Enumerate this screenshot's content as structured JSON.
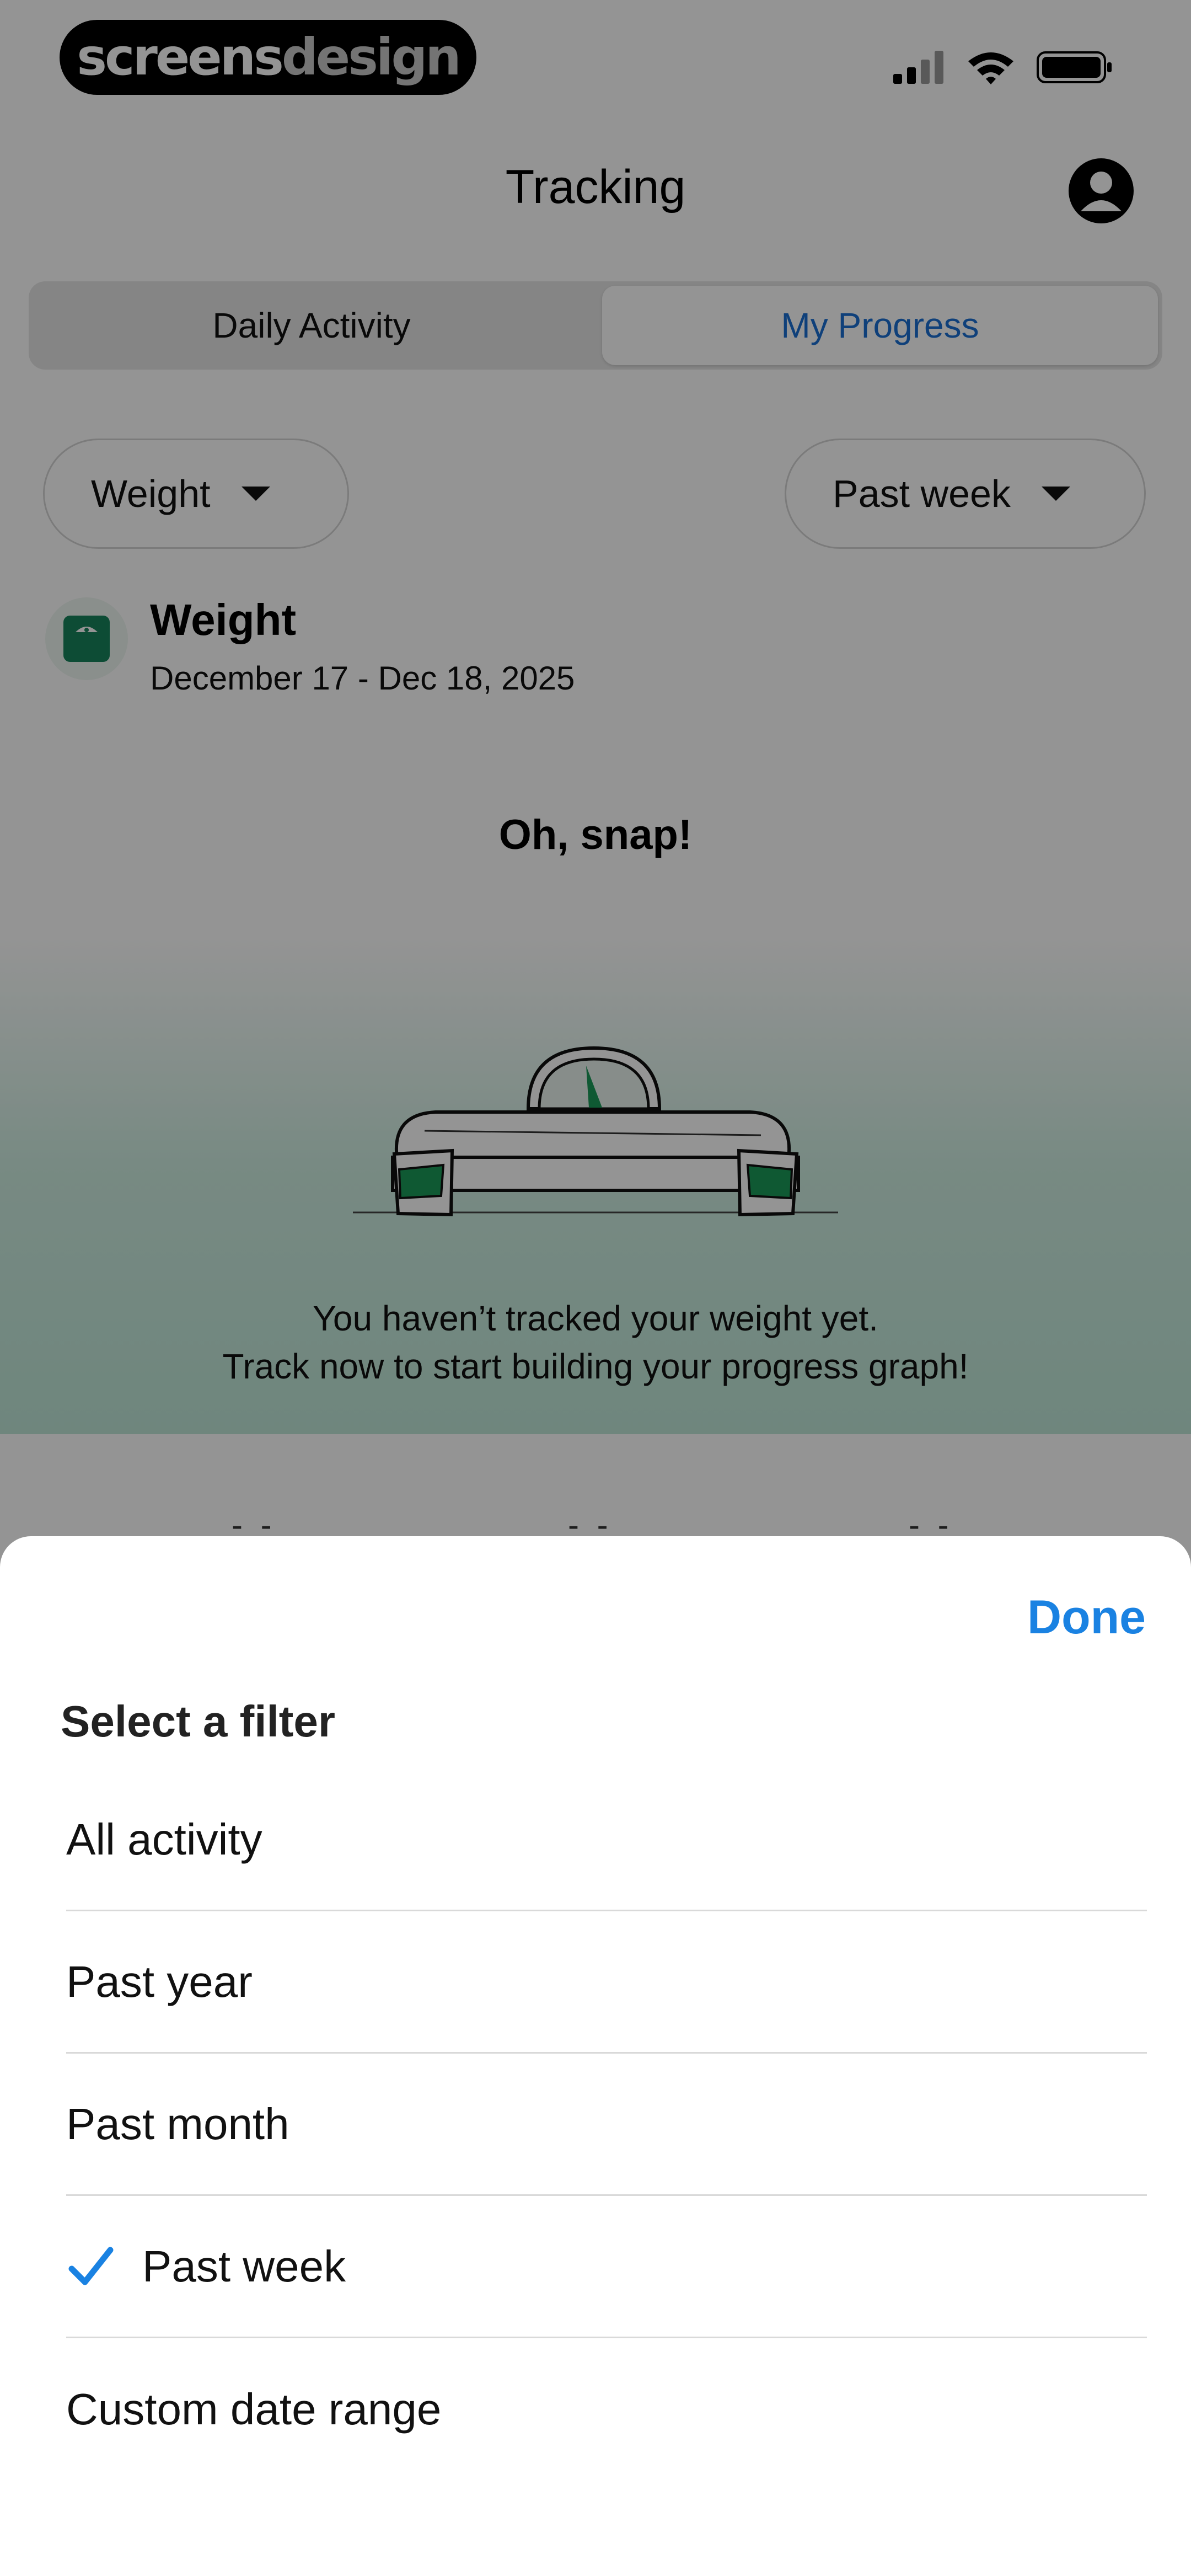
{
  "brand": {
    "part1": "screens",
    "part2": "design"
  },
  "header": {
    "title": "Tracking"
  },
  "tabs": [
    {
      "label": "Daily Activity",
      "active": false
    },
    {
      "label": "My Progress",
      "active": true
    }
  ],
  "filters": {
    "metric": "Weight",
    "range": "Past week"
  },
  "summary": {
    "title": "Weight",
    "date_range": "December 17 - Dec 18, 2025"
  },
  "empty_state": {
    "heading": "Oh, snap!",
    "line1": "You haven’t tracked your weight yet.",
    "line2": "Track now to start building your progress graph!"
  },
  "stats": [
    "- -",
    "- -",
    "- -"
  ],
  "sheet": {
    "done_label": "Done",
    "title": "Select a filter",
    "options": [
      {
        "label": "All activity",
        "selected": false
      },
      {
        "label": "Past year",
        "selected": false
      },
      {
        "label": "Past month",
        "selected": false
      },
      {
        "label": "Past week",
        "selected": true
      },
      {
        "label": "Custom date range",
        "selected": false
      }
    ]
  },
  "colors": {
    "accent": "#1a82e2",
    "tab_active_text": "#1a6fd3",
    "brand_green": "#17845c"
  }
}
